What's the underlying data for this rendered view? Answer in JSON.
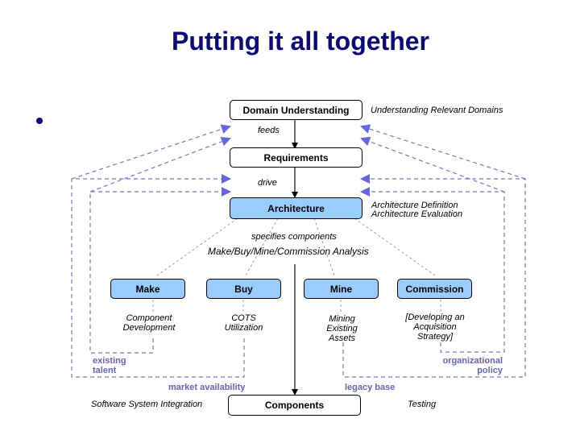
{
  "slide": {
    "title": "Putting it all together"
  },
  "boxes": {
    "domain_understanding": "Domain Understanding",
    "requirements": "Requirements",
    "architecture": "Architecture",
    "make": "Make",
    "buy": "Buy",
    "mine": "Mine",
    "commission": "Commission",
    "components": "Components"
  },
  "labels": {
    "understanding_relevant_domains": "Understanding Relevant Domains",
    "feeds": "feeds",
    "drive": "drive",
    "architecture_definition": "Architecture Definition",
    "architecture_evaluation": "Architecture Evaluation",
    "specifies_components": "specifies components",
    "analysis": "Make/Buy/Mine/Commission Analysis",
    "component_development": [
      "Component",
      "Development"
    ],
    "cots_utilization": [
      "COTS",
      "Utilization"
    ],
    "mining_existing_assets": [
      "Mining",
      "Existing",
      "Assets"
    ],
    "developing_acquisition_strategy": [
      "[Developing an",
      "Acquisition",
      "Strategy]"
    ],
    "software_system_integration": "Software System Integration",
    "testing": "Testing"
  },
  "feedback_labels": {
    "existing_talent": [
      "existing",
      "talent"
    ],
    "market_availability": "market availability",
    "organizational_policy": [
      "organizational",
      "policy"
    ],
    "legacy_base": "legacy base"
  },
  "colors": {
    "title": "#0a0a7a",
    "box_blue": "#99ccff",
    "feedback": "#6464b4",
    "arrowhead": "#6666dd"
  }
}
